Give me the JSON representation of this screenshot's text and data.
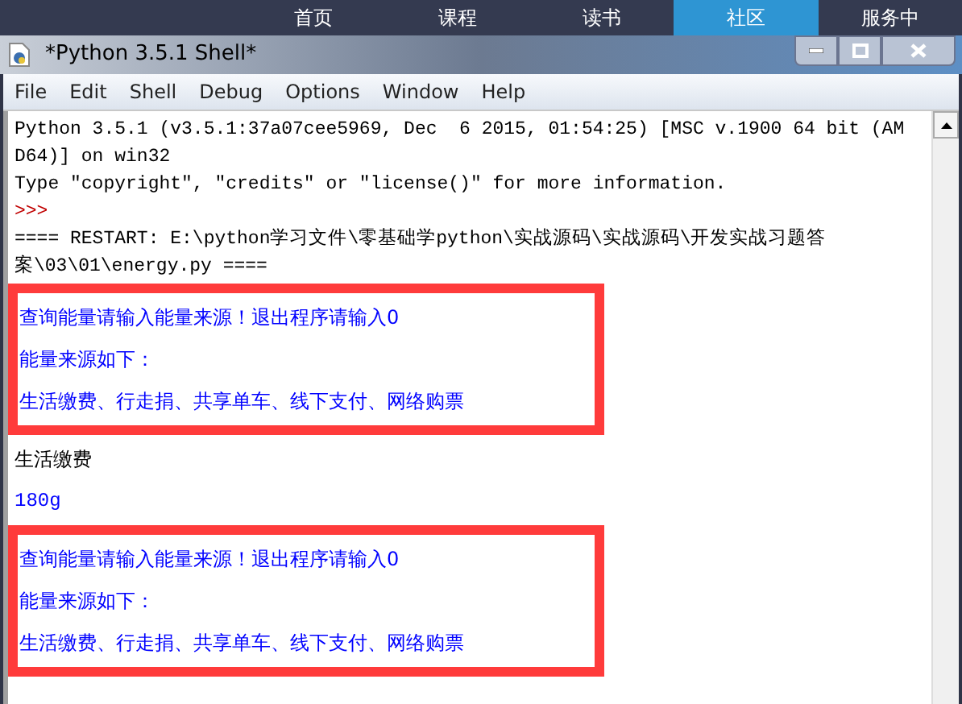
{
  "site_nav": [
    {
      "label": "首页",
      "selected": false
    },
    {
      "label": "课程",
      "selected": false
    },
    {
      "label": "读书",
      "selected": false
    },
    {
      "label": "社区",
      "selected": true
    },
    {
      "label": "服务中",
      "selected": false
    }
  ],
  "window": {
    "title": "*Python 3.5.1 Shell*"
  },
  "menu": [
    "File",
    "Edit",
    "Shell",
    "Debug",
    "Options",
    "Window",
    "Help"
  ],
  "shell": [
    {
      "kind": "output",
      "text": "Python 3.5.1 (v3.5.1:37a07cee5969, Dec  6 2015, 01:54:25) [MSC v.1900 64 bit (AM"
    },
    {
      "kind": "output",
      "text": "D64)] on win32"
    },
    {
      "kind": "output",
      "text": "Type \"copyright\", \"credits\" or \"license()\" for more information."
    },
    {
      "kind": "prompt",
      "text": ">>>"
    },
    {
      "kind": "output",
      "text": "==== RESTART: E:\\python学习文件\\零基础学python\\实战源码\\实战源码\\开发实战习题答"
    },
    {
      "kind": "output",
      "text": "案\\03\\01\\energy.py ===="
    },
    {
      "kind": "highlight",
      "lines": [
        "查询能量请输入能量来源！退出程序请输入0",
        "能量来源如下：",
        "生活缴费、行走捐、共享单车、线下支付、网络购票"
      ]
    },
    {
      "kind": "input",
      "text": "生活缴费"
    },
    {
      "kind": "program",
      "text": "180g"
    },
    {
      "kind": "highlight",
      "lines": [
        "查询能量请输入能量来源！退出程序请输入0",
        "能量来源如下：",
        "生活缴费、行走捐、共享单车、线下支付、网络购票"
      ]
    }
  ]
}
